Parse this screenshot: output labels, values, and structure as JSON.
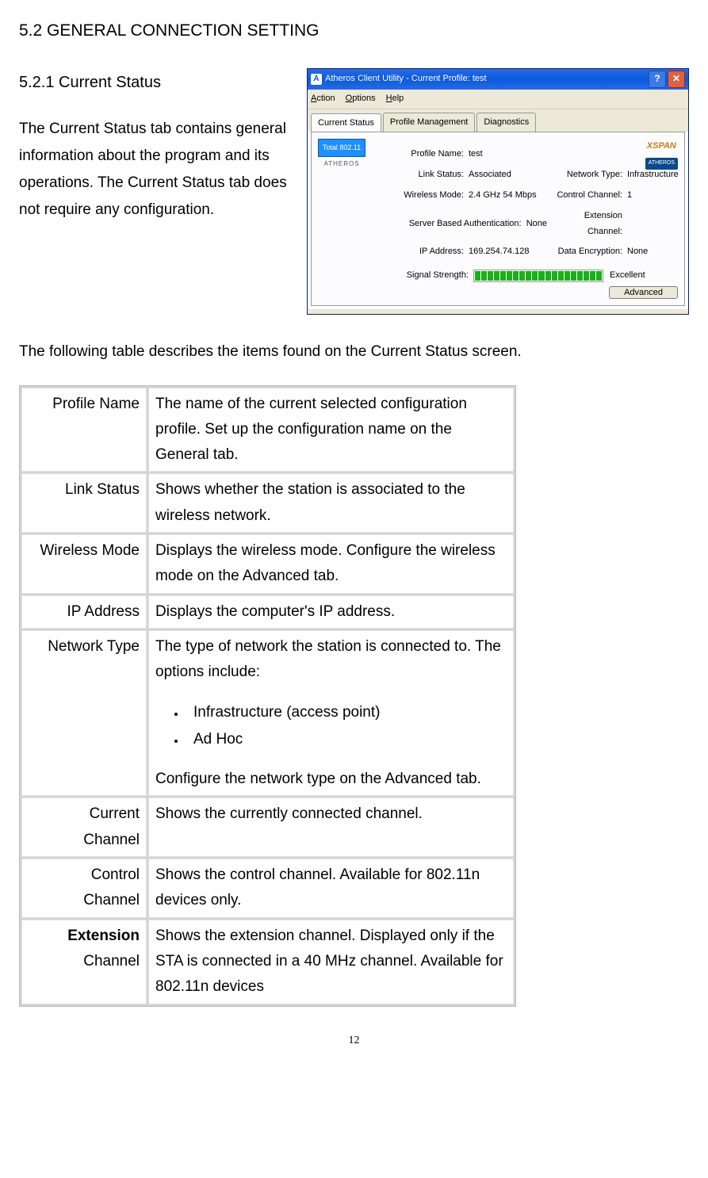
{
  "section_title": "5.2 GENERAL CONNECTION SETTING",
  "subsection_title": "5.2.1 Current Status",
  "intro_text": "The Current Status tab contains general information about the program and its operations. The Current Status tab does not require any configuration.",
  "below_text": "The following table describes the items found on the Current Status screen.",
  "page_number": "12",
  "window": {
    "title": "Atheros Client Utility - Current Profile: test",
    "menu": {
      "action": "Action",
      "options": "Options",
      "help": "Help"
    },
    "tabs": {
      "current": "Current Status",
      "profile": "Profile Management",
      "diag": "Diagnostics"
    },
    "badge_total": "Total 802.11",
    "badge_atheros": "ATHEROS",
    "brand_xspan": "XSPAN",
    "brand_atheros": "ATHEROS",
    "labels": {
      "profile_name": "Profile Name:",
      "link_status": "Link Status:",
      "wireless_mode": "Wireless Mode:",
      "network_type": "Network Type:",
      "control_channel": "Control Channel:",
      "server_auth": "Server Based Authentication:",
      "extension_channel": "Extension Channel:",
      "ip_address": "IP Address:",
      "data_encryption": "Data Encryption:",
      "signal_strength": "Signal Strength:"
    },
    "values": {
      "profile_name": "test",
      "link_status": "Associated",
      "wireless_mode": "2.4 GHz 54 Mbps",
      "network_type": "Infrastructure",
      "control_channel": "1",
      "server_auth": "None",
      "extension_channel": "",
      "ip_address": "169.254.74.128",
      "data_encryption": "None",
      "signal_strength": "Excellent"
    },
    "advanced_btn": "Advanced"
  },
  "table": {
    "rows": [
      {
        "label": "Profile Name",
        "desc": "The name of the current selected configuration profile.   Set up the configuration name on the General tab."
      },
      {
        "label": "Link Status",
        "desc": "Shows whether the station is associated to the wireless network."
      },
      {
        "label": "Wireless Mode",
        "desc": "Displays the wireless mode.   Configure the wireless mode on the Advanced tab."
      },
      {
        "label": "IP Address",
        "desc": "Displays the computer's   IP address."
      }
    ],
    "network_type": {
      "label": "Network Type",
      "desc_before": "The type of network the station is connected to.   The options include:",
      "opt1": "Infrastructure (access point)",
      "opt2": "Ad Hoc",
      "desc_after": "Configure the network type on the Advanced tab."
    },
    "current_channel": {
      "label1": "Current",
      "label2": "Channel",
      "desc": "Shows the currently connected channel."
    },
    "control_channel": {
      "label1": "Control",
      "label2": "Channel",
      "desc": "Shows the control channel. Available for 802.11n devices only."
    },
    "extension_channel": {
      "label1": "Extension",
      "label2": "Channel",
      "desc": "Shows the extension channel. Displayed only if the STA is connected in a 40 MHz channel. Available for 802.11n devices"
    }
  }
}
